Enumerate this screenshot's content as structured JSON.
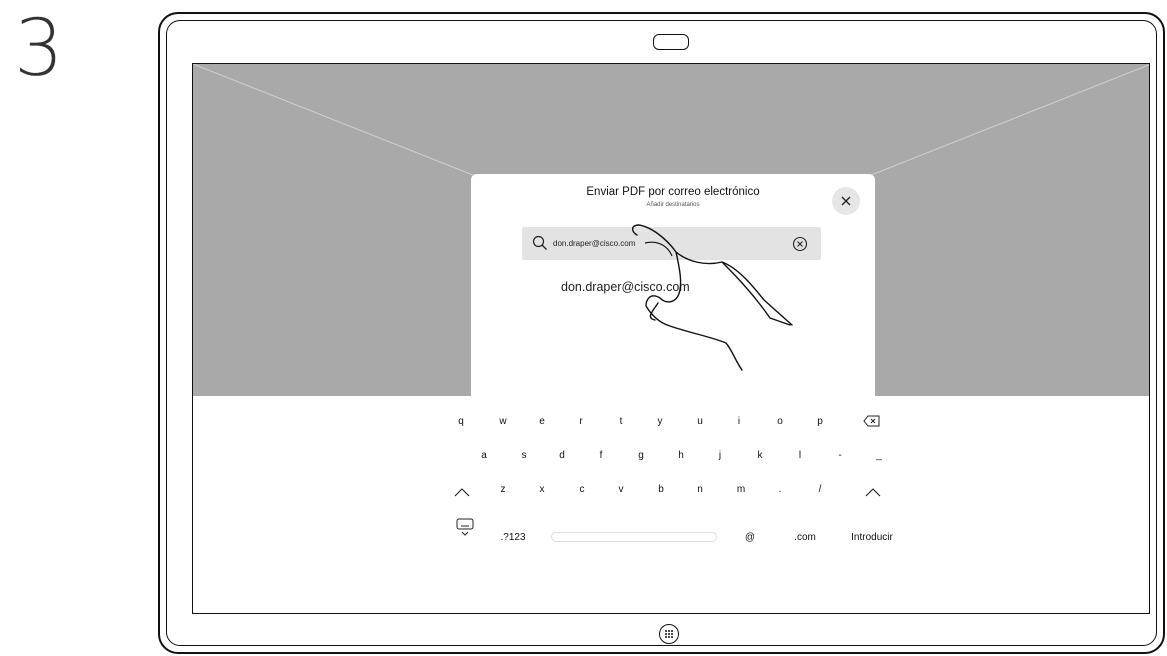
{
  "step": {
    "number": "3"
  },
  "modal": {
    "title": "Enviar PDF por correo electrónico",
    "subtitle": "Añadir destinatarios"
  },
  "search": {
    "value": "don.draper@cisco.com",
    "icon": "search-icon",
    "clear_icon": "clear-circle-icon"
  },
  "suggestion": {
    "label": "don.draper@cisco.com"
  },
  "keyboard": {
    "row1": [
      "q",
      "w",
      "e",
      "r",
      "t",
      "y",
      "u",
      "i",
      "o",
      "p"
    ],
    "row2": [
      "a",
      "s",
      "d",
      "f",
      "g",
      "h",
      "j",
      "k",
      "l",
      "-",
      "_"
    ],
    "row3": [
      "z",
      "x",
      "c",
      "v",
      "b",
      "n",
      "m",
      ".",
      "/"
    ],
    "numbers_label": ".?123",
    "at_label": "@",
    "com_label": ".com",
    "enter_label": "Introducir",
    "backspace_icon": "backspace-icon",
    "shift_icon": "shift-icon",
    "hide_keyboard_icon": "hide-keyboard-icon"
  },
  "colors": {
    "background_image": "#a9a9a9",
    "search_field": "#e3e3e3",
    "close_button": "#e6e6e6"
  }
}
